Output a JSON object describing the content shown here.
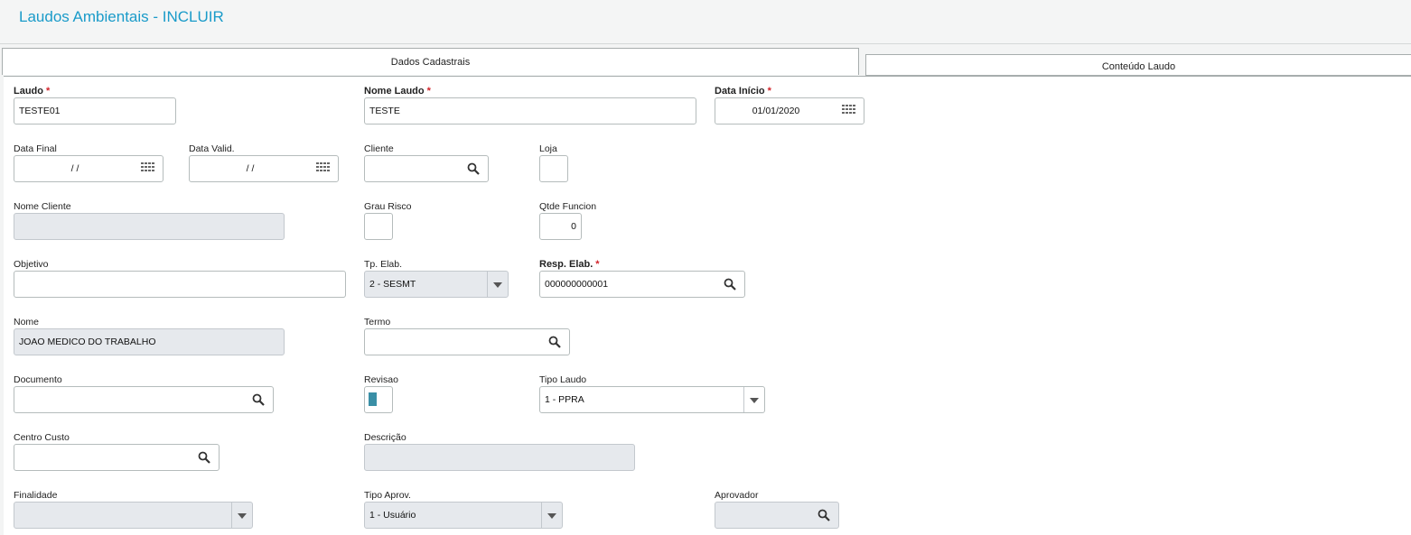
{
  "window": {
    "title": "Laudos Ambientais - INCLUIR"
  },
  "tabs": [
    {
      "label": "Dados Cadastrais",
      "active": true
    },
    {
      "label": "Conteúdo Laudo",
      "active": false
    }
  ],
  "form": {
    "laudo": {
      "label": "Laudo",
      "value": "TESTE01",
      "required": "*"
    },
    "nome_laudo": {
      "label": "Nome Laudo",
      "value": "TESTE",
      "required": "*"
    },
    "data_inicio": {
      "label": "Data Início",
      "value": "01/01/2020",
      "required": "*"
    },
    "data_final": {
      "label": "Data Final",
      "value": "/ /"
    },
    "data_valid": {
      "label": "Data Valid.",
      "value": "/ /"
    },
    "cliente": {
      "label": "Cliente",
      "value": ""
    },
    "loja": {
      "label": "Loja",
      "value": ""
    },
    "nome_cliente": {
      "label": "Nome Cliente",
      "value": ""
    },
    "grau_risco": {
      "label": "Grau Risco",
      "value": ""
    },
    "qtde_funcion": {
      "label": "Qtde Funcion",
      "value": "0"
    },
    "objetivo": {
      "label": "Objetivo",
      "value": ""
    },
    "tp_elab": {
      "label": "Tp. Elab.",
      "value": "2 - SESMT"
    },
    "resp_elab": {
      "label": "Resp. Elab.",
      "value": "000000000001",
      "required": "*"
    },
    "nome": {
      "label": "Nome",
      "value": "JOAO MEDICO DO TRABALHO"
    },
    "termo": {
      "label": "Termo",
      "value": ""
    },
    "documento": {
      "label": "Documento",
      "value": ""
    },
    "revisao": {
      "label": "Revisao",
      "value": ""
    },
    "tipo_laudo": {
      "label": "Tipo Laudo",
      "value": "1 - PPRA"
    },
    "centro_custo": {
      "label": "Centro Custo",
      "value": ""
    },
    "descricao": {
      "label": "Descrição",
      "value": ""
    },
    "finalidade": {
      "label": "Finalidade",
      "value": ""
    },
    "tipo_aprov": {
      "label": "Tipo Aprov.",
      "value": "1 - Usuário"
    },
    "aprovador": {
      "label": "Aprovador",
      "value": ""
    }
  },
  "colors": {
    "title": "#1a9bc9",
    "required": "#d2232a",
    "readonly_bg": "#e6e9ed"
  }
}
